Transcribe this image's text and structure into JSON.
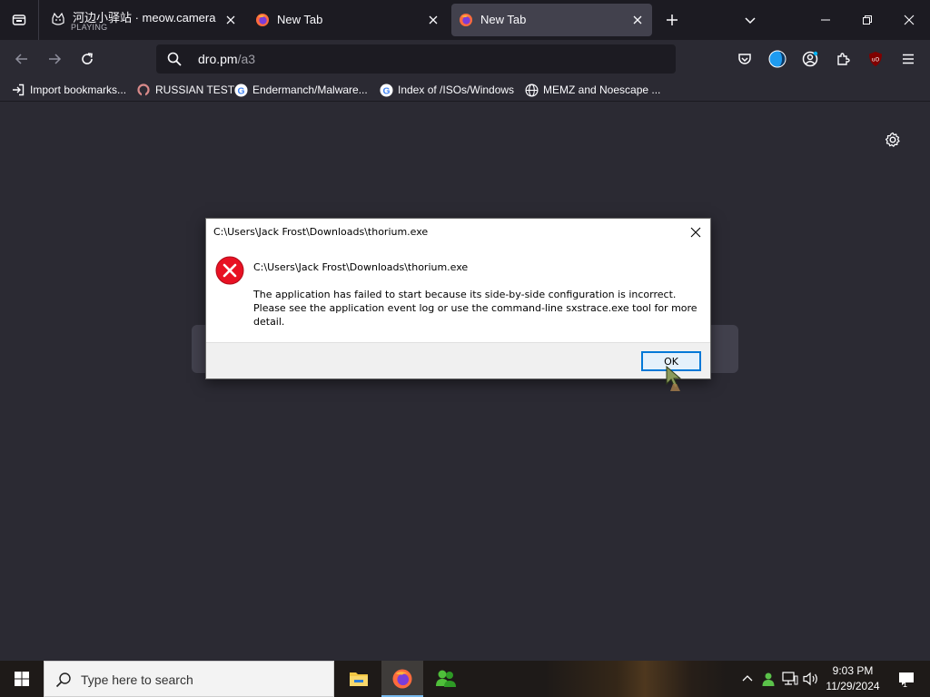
{
  "tabs": [
    {
      "title": "河边小驿站 · meow.camera",
      "subtitle": "PLAYING",
      "favicon": "cat-icon"
    },
    {
      "title": "New Tab",
      "favicon": "firefox-icon"
    },
    {
      "title": "New Tab",
      "favicon": "firefox-icon",
      "active": true
    }
  ],
  "navbar": {
    "url_host": "dro.pm",
    "url_path": "/a3"
  },
  "bookmarks": [
    {
      "label": "Import bookmarks...",
      "icon": "import-icon"
    },
    {
      "label": "RUSSIAN TEST",
      "icon": "loop-icon"
    },
    {
      "label": "Endermanch/Malware...",
      "icon": "google-icon"
    },
    {
      "label": "Index of /ISOs/Windows",
      "icon": "google-icon"
    },
    {
      "label": "MEMZ and Noescape ...",
      "icon": "globe-icon"
    }
  ],
  "dialog": {
    "title": "C:\\Users\\Jack Frost\\Downloads\\thorium.exe",
    "heading": "C:\\Users\\Jack Frost\\Downloads\\thorium.exe",
    "message": "The application has failed to start because its side-by-side configuration is incorrect. Please see the application event log or use the command-line sxstrace.exe tool for more detail.",
    "ok_label": "OK"
  },
  "taskbar": {
    "search_placeholder": "Type here to search",
    "time": "9:03 PM",
    "date": "11/29/2024",
    "notification_count": "1"
  },
  "colors": {
    "browser_bg": "#1c1b22",
    "toolbar_bg": "#2b2a33",
    "active_tab": "#42414d",
    "error_red": "#e81123",
    "dialog_accent": "#0078d7"
  }
}
